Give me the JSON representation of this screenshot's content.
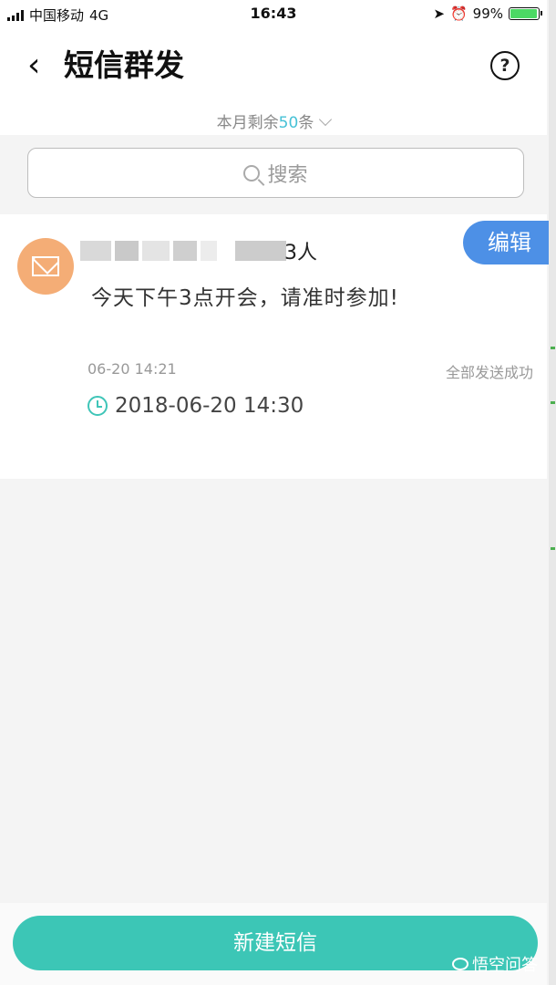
{
  "status_bar": {
    "carrier": "中国移动",
    "network": "4G",
    "time": "16:43",
    "battery_text": "99%",
    "battery_level": 0.99
  },
  "header": {
    "title": "短信群发",
    "help_label": "?"
  },
  "quota": {
    "prefix": "本月剩余",
    "count": "50",
    "suffix": "条"
  },
  "search": {
    "placeholder": "搜索"
  },
  "message_card": {
    "recipients_suffix": "3人",
    "edit_label": "编辑",
    "content": "今天下午3点开会，请准时参加!",
    "created_time": "06-20 14:21",
    "status": "全部发送成功",
    "scheduled_time": "2018-06-20 14:30"
  },
  "bottom": {
    "new_button_label": "新建短信"
  },
  "watermark": {
    "text": "悟空问答"
  },
  "colors": {
    "accent": "#3cc6b6",
    "edit_button": "#4d90e6",
    "avatar": "#f4ad76",
    "quota_number": "#46c1d6"
  }
}
